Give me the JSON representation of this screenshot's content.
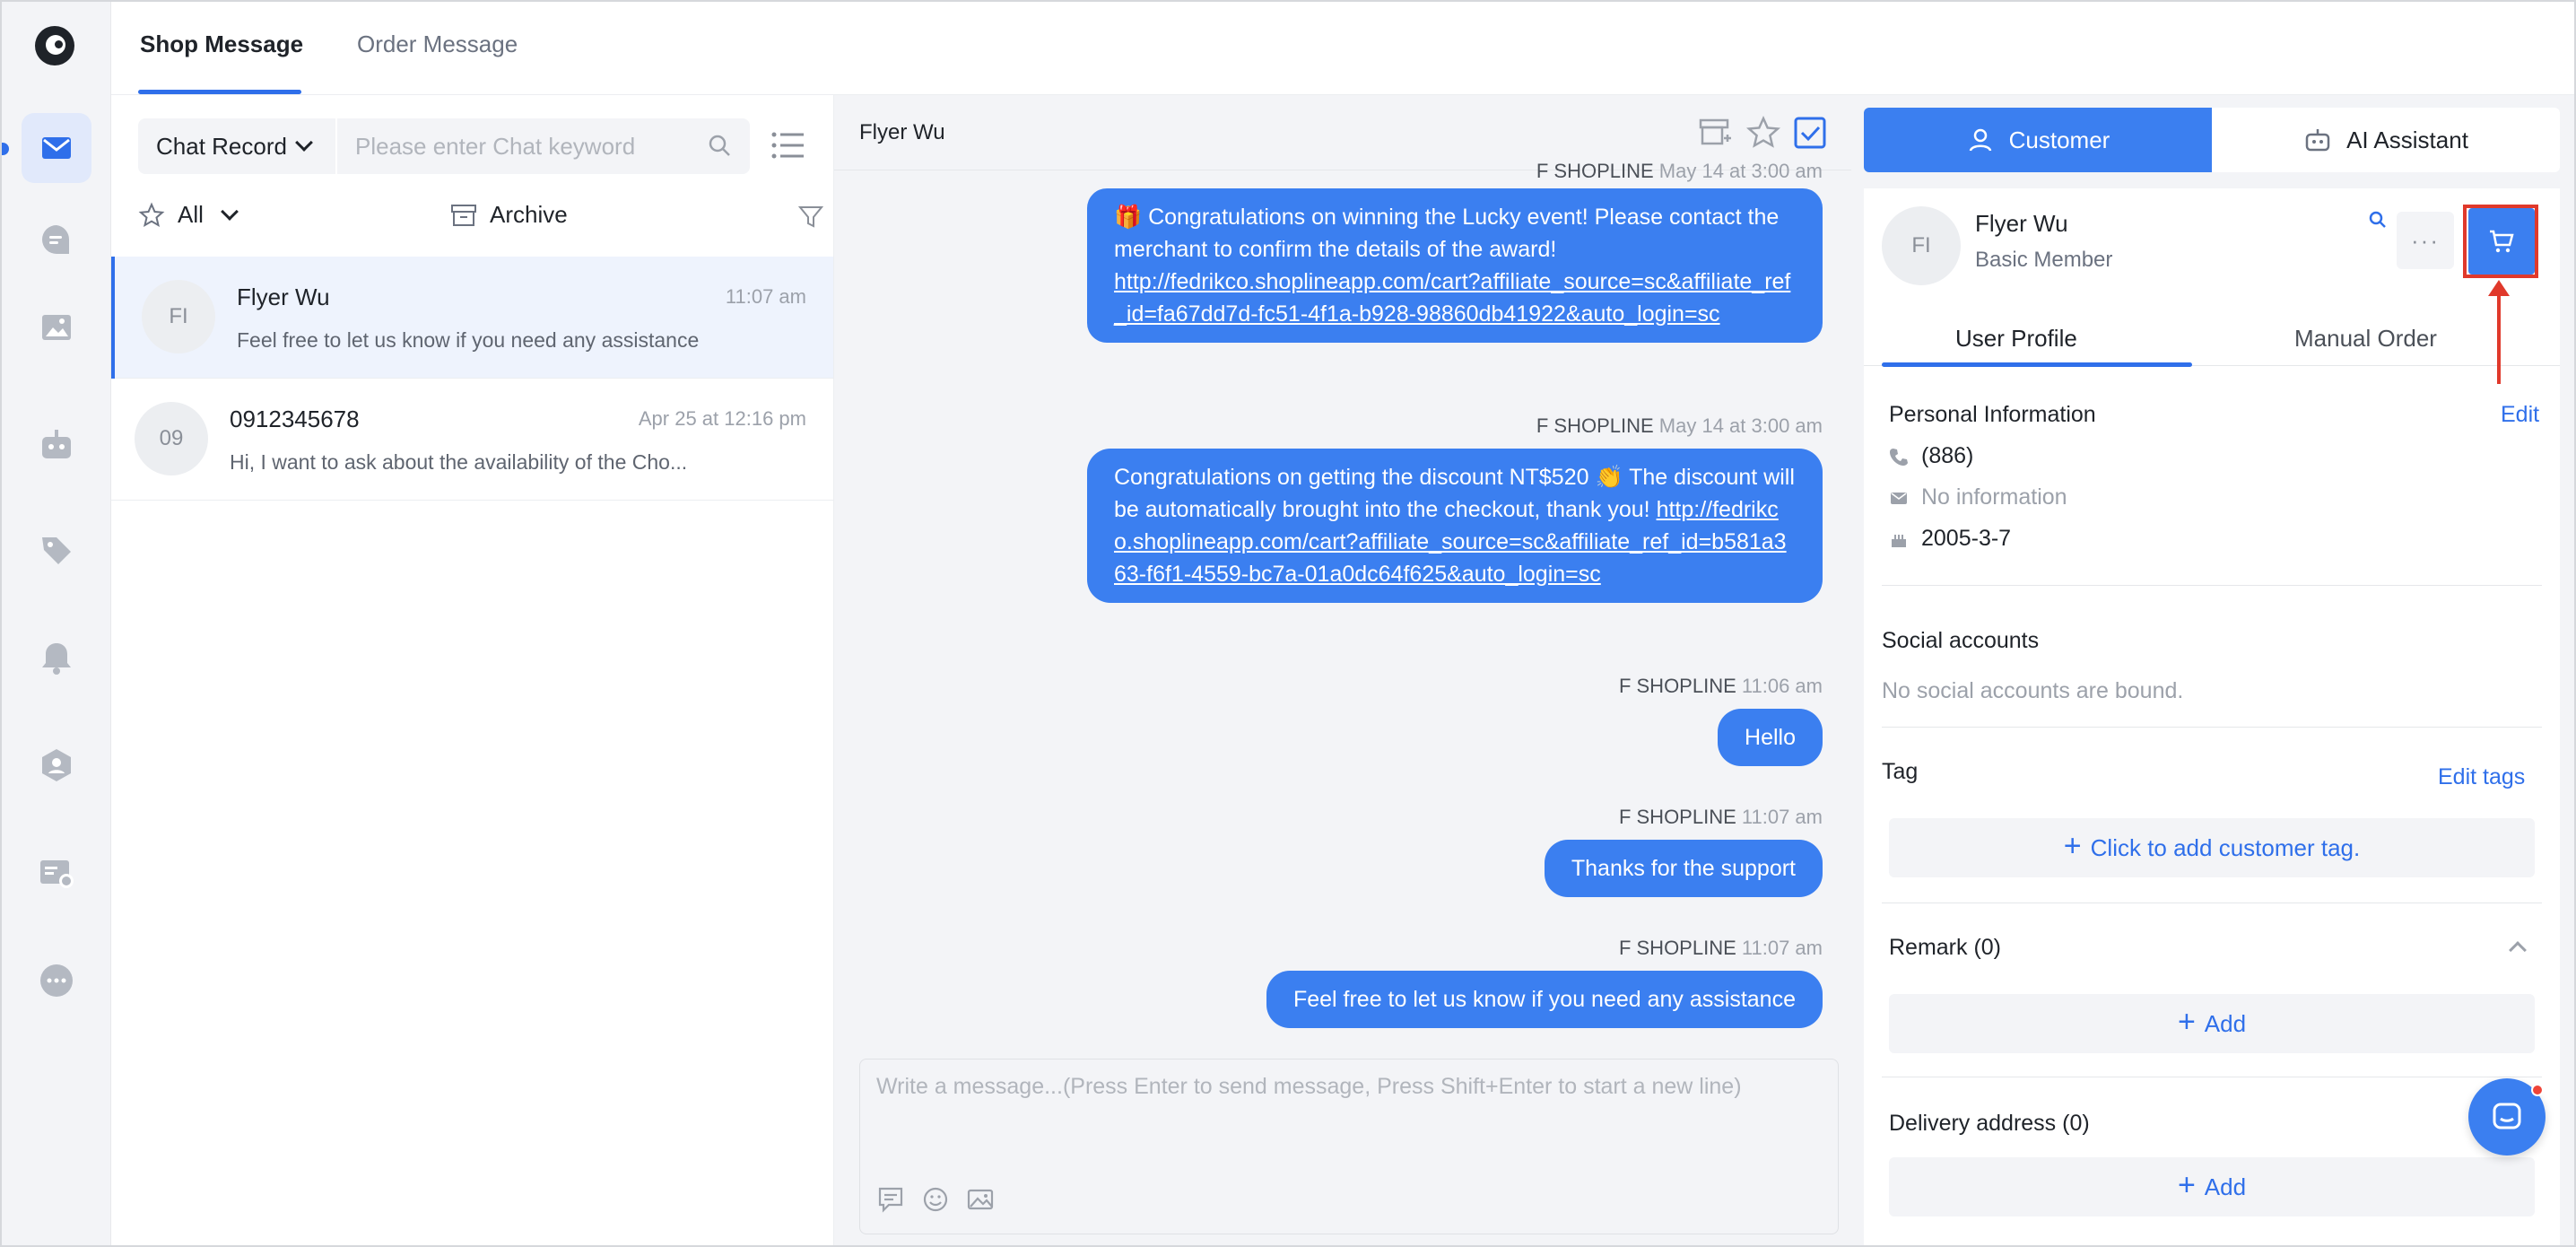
{
  "top_tabs": [
    {
      "label": "Shop Message",
      "active": true
    },
    {
      "label": "Order Message",
      "active": false
    }
  ],
  "rail": {
    "items": [
      "messages-icon",
      "chat-bubble-icon",
      "image-icon",
      "robot-icon",
      "tags-icon",
      "bell-icon",
      "contact-icon",
      "settings-chat-icon",
      "more-icon"
    ]
  },
  "conv_list": {
    "filter_select": "Chat Record",
    "search_placeholder": "Please enter Chat keyword",
    "star_filter": "All",
    "archive_label": "Archive",
    "items": [
      {
        "avatar": "FI",
        "name": "Flyer Wu",
        "time": "11:07 am",
        "preview": "Feel free to let us know if you need any assistance",
        "active": true
      },
      {
        "avatar": "09",
        "name": "0912345678",
        "time": "Apr 25 at 12:16 pm",
        "preview": "Hi, I want to ask about the availability of the Cho...",
        "active": false
      }
    ]
  },
  "chat": {
    "title": "Flyer Wu",
    "messages": [
      {
        "meta_sender": "F SHOPLINE",
        "meta_time": "May 14 at 3:00 am",
        "lines_before_link": "🎁 Congratulations on winning the Lucky event! Please contact the merchant to confirm the details of the award!",
        "link": "http://fedrikco.shoplineapp.com/cart?affiliate_source=sc&affiliate_ref_id=fa67dd7d-fc51-4f1a-b928-98860db41922&auto_login=sc"
      },
      {
        "meta_sender": "F SHOPLINE",
        "meta_time": "May 14 at 3:00 am",
        "lines_before_link": "Congratulations on getting the discount NT$520 👏 The discount will be automatically brought into the checkout, thank you!",
        "link": "http://fedrikco.shoplineapp.com/cart?affiliate_source=sc&affiliate_ref_id=b581a363-f6f1-4559-bc7a-01a0dc64f625&auto_login=sc"
      },
      {
        "meta_sender": "F SHOPLINE",
        "meta_time": "11:06 am",
        "text": "Hello"
      },
      {
        "meta_sender": "F SHOPLINE",
        "meta_time": "11:07 am",
        "text": "Thanks for the support"
      },
      {
        "meta_sender": "F SHOPLINE",
        "meta_time": "11:07 am",
        "text": "Feel free to let us know if you need any assistance"
      }
    ],
    "composer_placeholder": "Write a message...(Press Enter to send message, Press Shift+Enter to start a new line)"
  },
  "side": {
    "tabs": [
      {
        "label": "Customer",
        "active": true
      },
      {
        "label": "AI Assistant",
        "active": false
      }
    ],
    "customer": {
      "avatar": "FI",
      "name": "Flyer Wu",
      "level": "Basic Member",
      "more": "···"
    },
    "profile_tabs": [
      {
        "label": "User Profile",
        "active": true
      },
      {
        "label": "Manual Order",
        "active": false
      }
    ],
    "personal_info": {
      "title": "Personal Information",
      "edit": "Edit",
      "phone": "(886)",
      "email": "No information",
      "birthday": "2005-3-7"
    },
    "social": {
      "title": "Social accounts",
      "empty": "No social accounts are bound."
    },
    "tag": {
      "title": "Tag",
      "edit": "Edit tags",
      "add": "Click to add customer tag."
    },
    "remark": {
      "title": "Remark (0)",
      "add": "Add"
    },
    "delivery": {
      "title": "Delivery address (0)",
      "add": "Add"
    }
  },
  "colors": {
    "accent": "#3b7ff0",
    "highlight": "#e0392b"
  }
}
